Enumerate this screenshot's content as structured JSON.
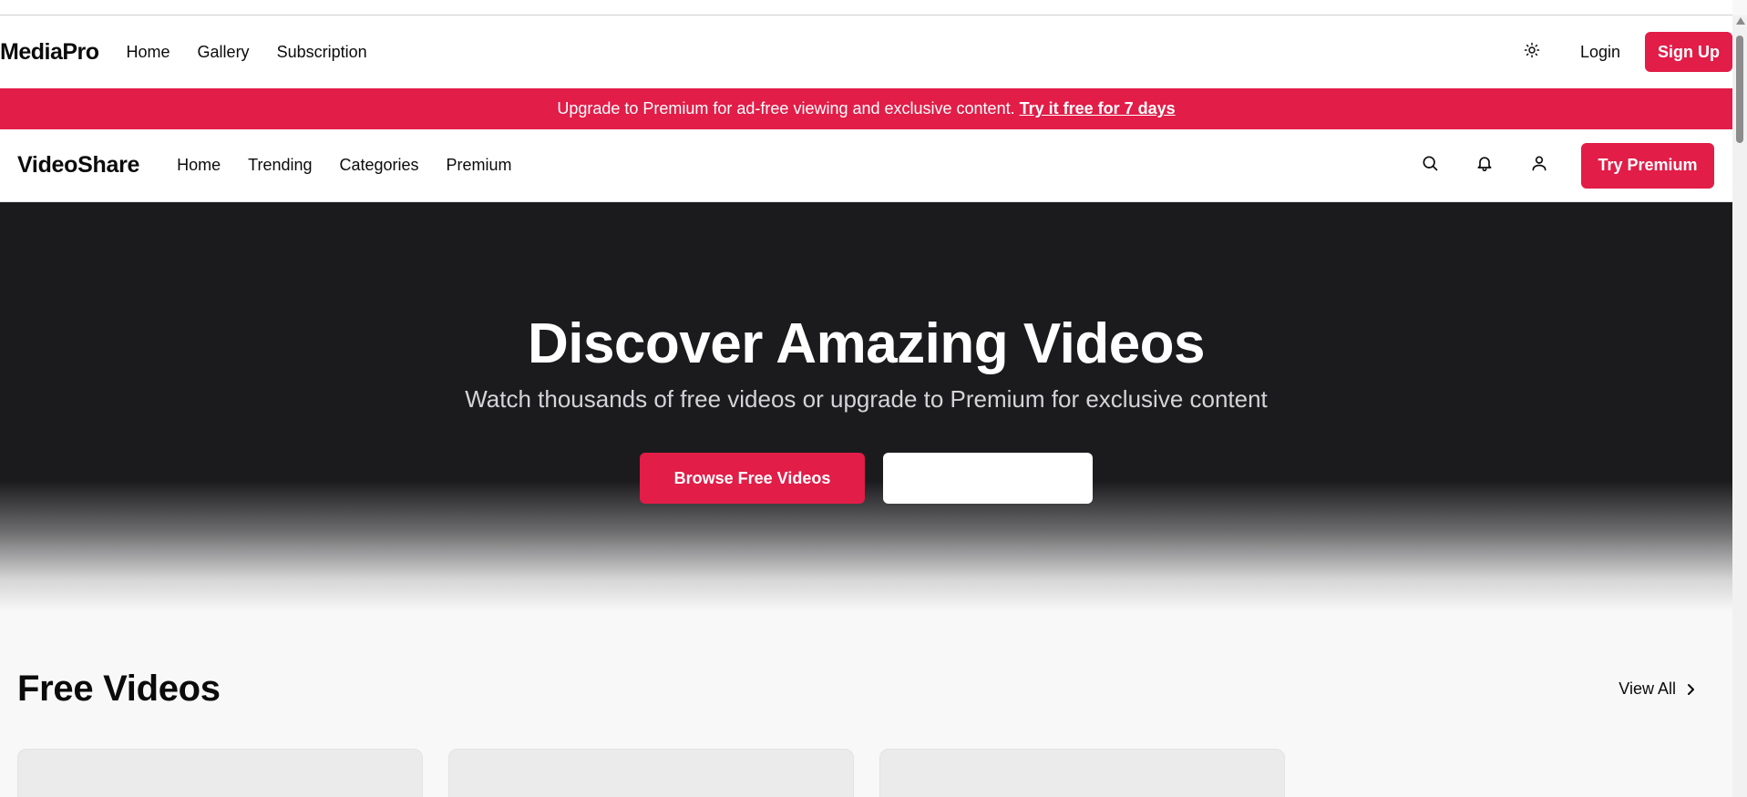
{
  "mediapro": {
    "logo": "MediaPro",
    "nav": [
      "Home",
      "Gallery",
      "Subscription"
    ],
    "login_label": "Login",
    "signup_label": "Sign Up",
    "theme_icon": "sun-icon"
  },
  "promo": {
    "text": "Upgrade to Premium for ad-free viewing and exclusive content.",
    "link": "Try it free for 7 days"
  },
  "videoshare": {
    "logo": "VideoShare",
    "nav": [
      "Home",
      "Trending",
      "Categories",
      "Premium"
    ],
    "icons": [
      "search-icon",
      "bell-icon",
      "user-icon"
    ],
    "cta_label": "Try Premium"
  },
  "hero": {
    "title": "Discover Amazing Videos",
    "subtitle": "Watch thousands of free videos or upgrade to Premium for exclusive content",
    "primary_button": "Browse Free Videos",
    "secondary_button": ""
  },
  "free_videos": {
    "title": "Free Videos",
    "view_all": "View All",
    "card_count": 3
  },
  "colors": {
    "accent": "#e11d48",
    "hero_bg": "#1b1b1d",
    "page_bg": "#f8f8f8"
  }
}
